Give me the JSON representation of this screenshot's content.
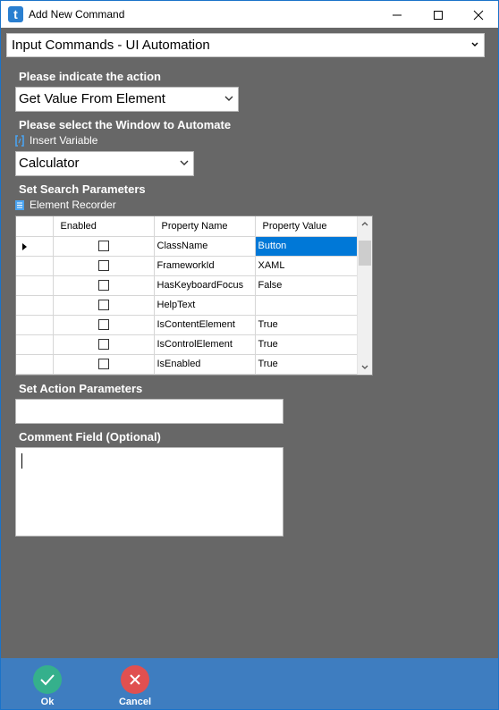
{
  "window": {
    "title": "Add New Command",
    "app_icon_letter": "t"
  },
  "command_category": "Input Commands - UI Automation",
  "action": {
    "label": "Please indicate the action",
    "selected": "Get Value From Element"
  },
  "window_select": {
    "label": "Please select the Window to Automate",
    "insert_variable": "Insert Variable",
    "selected": "Calculator"
  },
  "search_params": {
    "label": "Set Search Parameters",
    "element_recorder": "Element Recorder",
    "columns": [
      "Enabled",
      "Property Name",
      "Property Value"
    ],
    "rows": [
      {
        "enabled": false,
        "name": "ClassName",
        "value": "Button"
      },
      {
        "enabled": false,
        "name": "FrameworkId",
        "value": "XAML"
      },
      {
        "enabled": false,
        "name": "HasKeyboardFocus",
        "value": "False"
      },
      {
        "enabled": false,
        "name": "HelpText",
        "value": ""
      },
      {
        "enabled": false,
        "name": "IsContentElement",
        "value": "True"
      },
      {
        "enabled": false,
        "name": "IsControlElement",
        "value": "True"
      },
      {
        "enabled": false,
        "name": "IsEnabled",
        "value": "True"
      }
    ]
  },
  "action_params": {
    "label": "Set Action Parameters",
    "value": ""
  },
  "comment": {
    "label": "Comment Field (Optional)",
    "value": ""
  },
  "footer": {
    "ok_label": "Ok",
    "cancel_label": "Cancel"
  },
  "colors": {
    "background": "#676767",
    "footer": "#3e7dc0",
    "ok_button": "#35b08c",
    "cancel_button": "#e05050",
    "selection": "#0078d7"
  }
}
